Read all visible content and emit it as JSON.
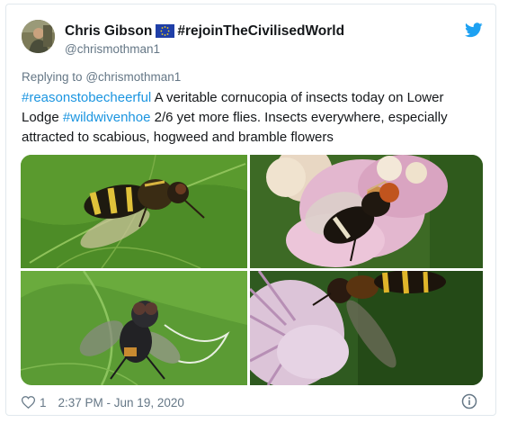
{
  "tweet": {
    "author_name": "Chris Gibson",
    "author_suffix": "#rejoinTheCivilisedWorld",
    "handle": "@chrismothman1",
    "reply_prefix": "Replying to",
    "reply_to": "@chrismothman1",
    "text_parts": {
      "hashtag1": "#reasonstobecheerful",
      "text1": " A veritable cornucopia of insects today on Lower Lodge ",
      "hashtag2": "#wildwivenhoe",
      "text2": " 2/6 yet more flies. Insects everywhere, especially attracted to scabious, hogweed and bramble flowers"
    },
    "likes": "1",
    "timestamp": "2:37 PM - Jun 19, 2020"
  },
  "colors": {
    "link": "#1b95e0",
    "muted": "#657786",
    "text": "#14171a",
    "border": "#e1e8ed",
    "twitter_blue": "#1da1f2"
  },
  "icons": {
    "brand": "twitter-bird-icon",
    "flag": "eu-flag-icon",
    "like": "heart-icon",
    "info": "info-icon"
  }
}
